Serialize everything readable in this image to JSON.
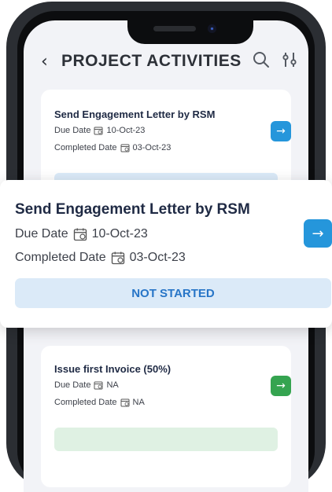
{
  "header": {
    "back_glyph": "‹",
    "title": "PROJECT ACTIVITIES",
    "search_icon": "search-icon",
    "filter_icon": "filter-sliders-icon"
  },
  "cards": [
    {
      "title": "Send Engagement Letter by RSM",
      "due_label": "Due Date",
      "due_value": "10-Oct-23",
      "completed_label": "Completed Date",
      "completed_value": "03-Oct-23",
      "status": "NOT STARTED",
      "arrow_color": "#2596db"
    },
    {
      "title": "Issue first Invoice (50%)",
      "due_label": "Due Date",
      "due_value": "NA",
      "completed_label": "Completed Date",
      "completed_value": "NA",
      "status": "",
      "arrow_color": "#35a450"
    }
  ],
  "popup": {
    "title": "Send Engagement Letter by RSM",
    "due_label": "Due Date",
    "due_value": "10-Oct-23",
    "completed_label": "Completed Date",
    "completed_value": "03-Oct-23",
    "status": "NOT STARTED"
  },
  "colors": {
    "accent_blue": "#2596db",
    "status_bg": "#dbeaf8",
    "status_text": "#2775c7",
    "accent_green": "#35a450"
  }
}
